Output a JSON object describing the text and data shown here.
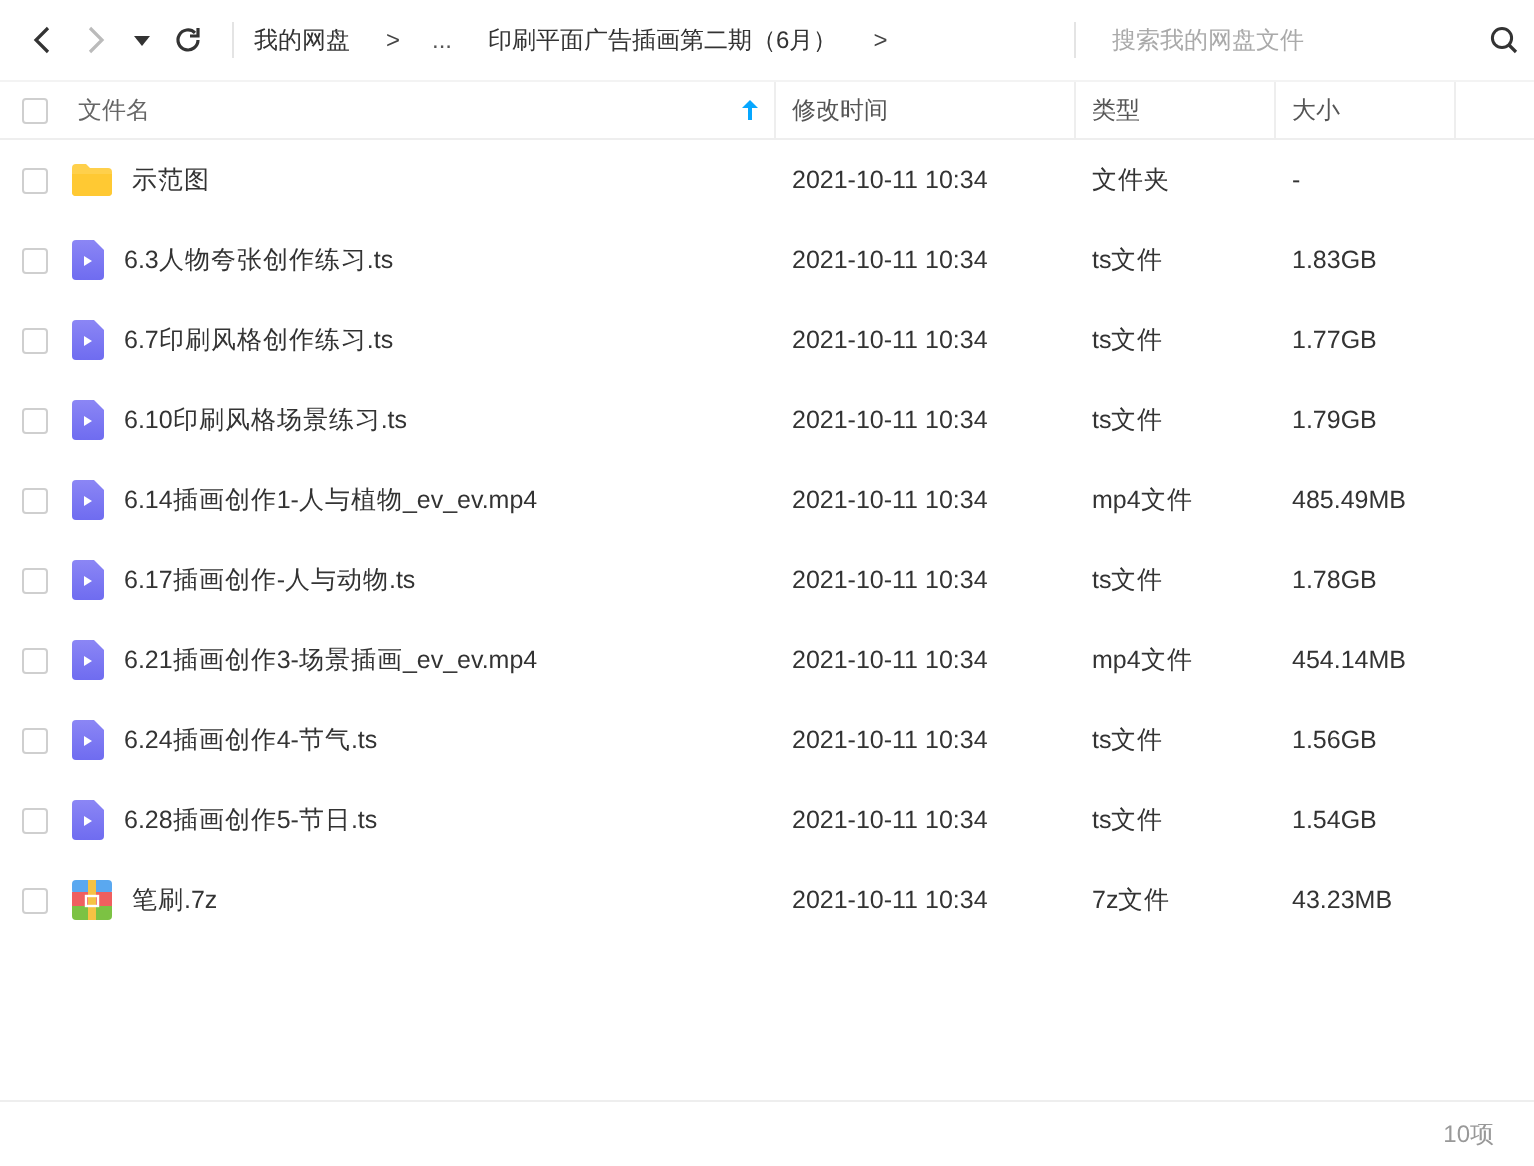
{
  "toolbar": {
    "back_enabled": true,
    "forward_enabled": false,
    "breadcrumb": [
      {
        "label": "我的网盘"
      },
      {
        "label": ">",
        "kind": "sep"
      },
      {
        "label": "...",
        "kind": "more"
      },
      {
        "label": "印刷平面广告插画第二期（6月）"
      },
      {
        "label": ">",
        "kind": "sep"
      }
    ],
    "search": {
      "placeholder": "搜索我的网盘文件"
    }
  },
  "table": {
    "columns": [
      {
        "label": "文件名",
        "sorted": true
      },
      {
        "label": "修改时间",
        "sorted": false
      },
      {
        "label": "类型",
        "sorted": false
      },
      {
        "label": "大小",
        "sorted": false
      }
    ],
    "select_all": false,
    "rows": [
      {
        "kind": "folder",
        "name": "示范图",
        "modified": "2021-10-11 10:34",
        "type": "文件夹",
        "size": "-",
        "checked": false
      },
      {
        "kind": "video",
        "name": "6.3人物夸张创作练习.ts",
        "modified": "2021-10-11 10:34",
        "type": "ts文件",
        "size": "1.83GB",
        "checked": false
      },
      {
        "kind": "video",
        "name": "6.7印刷风格创作练习.ts",
        "modified": "2021-10-11 10:34",
        "type": "ts文件",
        "size": "1.77GB",
        "checked": false
      },
      {
        "kind": "video",
        "name": "6.10印刷风格场景练习.ts",
        "modified": "2021-10-11 10:34",
        "type": "ts文件",
        "size": "1.79GB",
        "checked": false
      },
      {
        "kind": "video",
        "name": "6.14插画创作1-人与植物_ev_ev.mp4",
        "modified": "2021-10-11 10:34",
        "type": "mp4文件",
        "size": "485.49MB",
        "checked": false
      },
      {
        "kind": "video",
        "name": "6.17插画创作-人与动物.ts",
        "modified": "2021-10-11 10:34",
        "type": "ts文件",
        "size": "1.78GB",
        "checked": false
      },
      {
        "kind": "video",
        "name": "6.21插画创作3-场景插画_ev_ev.mp4",
        "modified": "2021-10-11 10:34",
        "type": "mp4文件",
        "size": "454.14MB",
        "checked": false
      },
      {
        "kind": "video",
        "name": "6.24插画创作4-节气.ts",
        "modified": "2021-10-11 10:34",
        "type": "ts文件",
        "size": "1.56GB",
        "checked": false
      },
      {
        "kind": "video",
        "name": "6.28插画创作5-节日.ts",
        "modified": "2021-10-11 10:34",
        "type": "ts文件",
        "size": "1.54GB",
        "checked": false
      },
      {
        "kind": "archive",
        "name": "笔刷.7z",
        "modified": "2021-10-11 10:34",
        "type": "7z文件",
        "size": "43.23MB",
        "checked": false
      }
    ]
  },
  "status_bar": {
    "count": "10项"
  }
}
